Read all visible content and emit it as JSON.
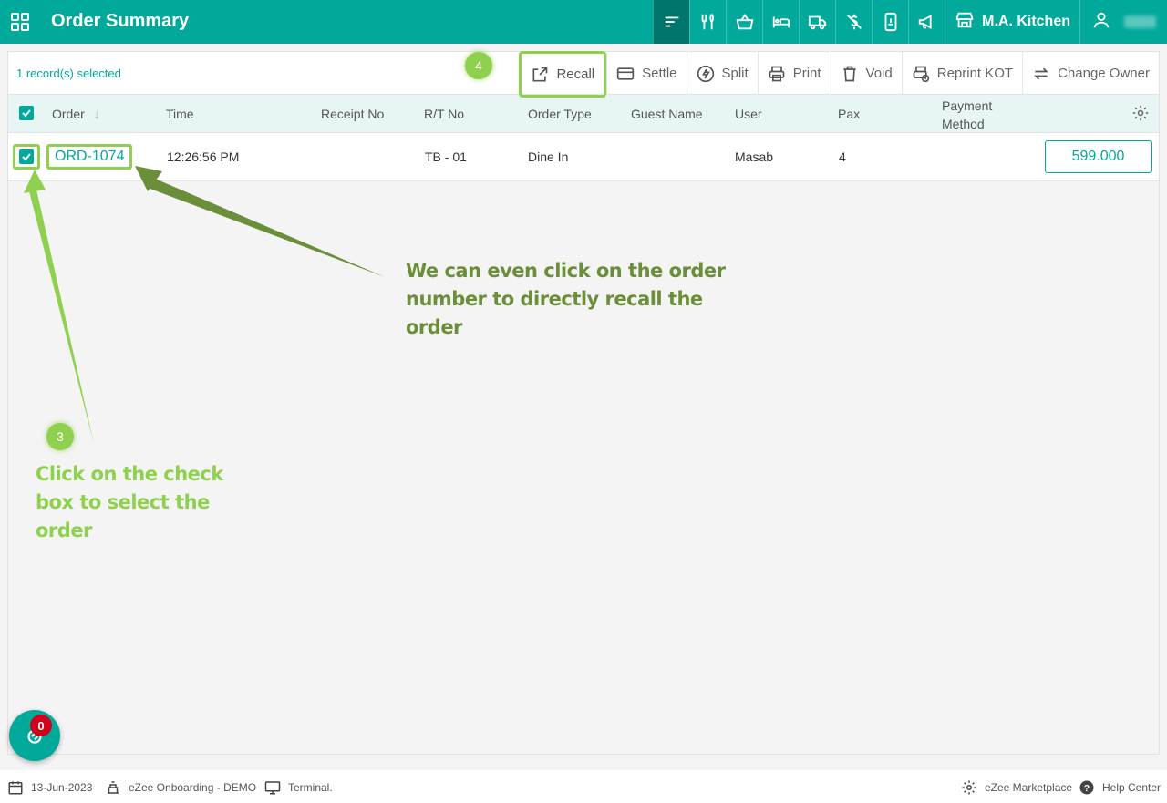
{
  "header": {
    "title": "Order Summary",
    "kitchen_name": "M.A. Kitchen",
    "user_name": "",
    "brand_color": "#00a99a",
    "icons": [
      "sort-icon",
      "dine-in-icon",
      "basket-icon",
      "room-icon",
      "delivery-icon",
      "no-charge-icon",
      "mobile-order-icon",
      "announcement-icon",
      "store-icon",
      "user-icon"
    ]
  },
  "toolbar": {
    "selected_text": "1 record(s) selected",
    "actions": {
      "recall": "Recall",
      "settle": "Settle",
      "split": "Split",
      "print": "Print",
      "void": "Void",
      "reprint_kot": "Reprint KOT",
      "change_owner": "Change Owner"
    }
  },
  "table": {
    "columns": {
      "order": "Order",
      "time": "Time",
      "receipt_no": "Receipt No",
      "rt_no": "R/T No",
      "order_type": "Order Type",
      "guest_name": "Guest Name",
      "user": "User",
      "pax": "Pax",
      "payment_method_1": "Payment",
      "payment_method_2": "Method"
    },
    "rows": [
      {
        "checked": true,
        "order": "ORD-1074",
        "time": "12:26:56 PM",
        "receipt_no": "",
        "rt_no": "TB - 01",
        "order_type": "Dine In",
        "guest_name": "",
        "user": "Masab",
        "pax": "4",
        "payment_method": "",
        "amount": "599.000"
      }
    ]
  },
  "annotations": {
    "step3_number": "3",
    "step4_number": "4",
    "step3_line1": "Click on the check",
    "step3_line2": "box to select the",
    "step3_line3": "order",
    "order_note_line1": "We can even click on the order",
    "order_note_line2": "number to directly recall the",
    "order_note_line3": "order",
    "highlight_color": "#8fd14f",
    "note_color": "#6b8e3a"
  },
  "fab": {
    "badge": "0"
  },
  "footer": {
    "date": "13-Jun-2023",
    "property": "eZee Onboarding - DEMO",
    "terminal": "Terminal.",
    "marketplace": "eZee Marketplace",
    "help": "Help Center"
  }
}
